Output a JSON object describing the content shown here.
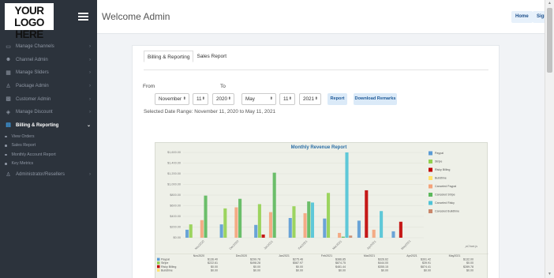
{
  "logo": {
    "line1": "YOUR LOGO",
    "line2": "HERE"
  },
  "header": {
    "welcome": "Welcome Admin",
    "home": "Home",
    "sign_out": "Sign Out"
  },
  "sidebar": {
    "items": [
      {
        "label": "Manage Channels",
        "icon": "tv-icon"
      },
      {
        "label": "Channel Admin",
        "icon": "users-icon"
      },
      {
        "label": "Manage Sliders",
        "icon": "image-icon"
      },
      {
        "label": "Package Admin",
        "icon": "user-icon"
      },
      {
        "label": "Customer Admin",
        "icon": "grid-icon"
      },
      {
        "label": "Manage Discount",
        "icon": "tag-icon"
      },
      {
        "label": "Billing & Reporting",
        "icon": "file-icon",
        "active": true
      }
    ],
    "sub_items": [
      "View Orders",
      "Sales Report",
      "Monthly Account Report",
      "Key Metrics"
    ],
    "last_item": {
      "label": "Administrator/Resellers",
      "icon": "user-icon"
    }
  },
  "tabs": {
    "billing": "Billing & Reporting",
    "sales": "Sales Report"
  },
  "form": {
    "from_label": "From",
    "to_label": "To",
    "from_month": "November",
    "from_day": "11",
    "from_year": "2020",
    "to_month": "May",
    "to_day": "11",
    "to_year": "2021",
    "report_button": "Report",
    "download_button": "Download Remarks"
  },
  "date_range_text": "Selected Date Range: November 11, 2020 to May 11, 2021",
  "chart_data": {
    "type": "bar",
    "title": "Monthly Revenue Report",
    "y_ticks": [
      "$1,600.00",
      "$1,400.00",
      "$1,200.00",
      "$1,000.00",
      "$800.00",
      "$600.00",
      "$400.00",
      "$200.00",
      "$0.00"
    ],
    "ylim": [
      0,
      1600
    ],
    "categories": [
      "Nov2020",
      "Dec2020",
      "Jan2021",
      "Feb2021",
      "Mar2021",
      "Apr2021",
      "May2021"
    ],
    "series": [
      {
        "name": "Paypal",
        "color": "#5b9bd5",
        "values": [
          150,
          250,
          240,
          370,
          360,
          320,
          120
        ]
      },
      {
        "name": "Stripe",
        "color": "#92d050",
        "values": [
          250,
          550,
          630,
          590,
          840,
          0,
          0
        ]
      },
      {
        "name": "Risky Billing",
        "color": "#c00000",
        "values": [
          0,
          0,
          60,
          0,
          0,
          890,
          300
        ]
      },
      {
        "name": "Buildtime",
        "color": "#ffe36e",
        "values": [
          0,
          0,
          0,
          0,
          0,
          0,
          0
        ]
      },
      {
        "name": "Canceled Paypal",
        "color": "#f4a37a",
        "values": [
          330,
          570,
          480,
          460,
          90,
          150,
          0
        ]
      },
      {
        "name": "Canceled Stripe",
        "color": "#5cb85c",
        "values": [
          790,
          730,
          1220,
          680,
          20,
          0,
          0
        ]
      },
      {
        "name": "Canceled Risky",
        "color": "#4fc3d6",
        "values": [
          0,
          0,
          0,
          660,
          1600,
          500,
          0
        ]
      },
      {
        "name": "Canceled Buildtime",
        "color": "#c9876b",
        "values": [
          0,
          0,
          0,
          0,
          40,
          0,
          0
        ]
      }
    ],
    "credit": "pChart.js",
    "table": {
      "headers": [
        "",
        "Nov2020",
        "Dec2020",
        "Jan2021",
        "Feb2021",
        "Mar2021",
        "Apr2021",
        "May2021"
      ],
      "rows": [
        {
          "name": "Paypal",
          "color": "#5b9bd5",
          "cells": [
            "$136.40",
            "$299.78",
            "$275.46",
            "$386.85",
            "$326.62",
            "$391.42",
            "$132.00"
          ]
        },
        {
          "name": "Stripe",
          "color": "#92d050",
          "cells": [
            "$222.61",
            "$498.28",
            "$587.97",
            "$874.75",
            "$444.00",
            "$39.91",
            "$0.00"
          ]
        },
        {
          "name": "Risky Billing",
          "color": "#c00000",
          "cells": [
            "$0.00",
            "$0.00",
            "$0.00",
            "$481.44",
            "$355.15",
            "$874.41",
            "$289.78"
          ]
        },
        {
          "name": "Buildtime",
          "color": "#ffe36e",
          "cells": [
            "$0.00",
            "$0.00",
            "$0.00",
            "$0.00",
            "$0.00",
            "$0.00",
            "$0.00"
          ]
        }
      ]
    }
  }
}
